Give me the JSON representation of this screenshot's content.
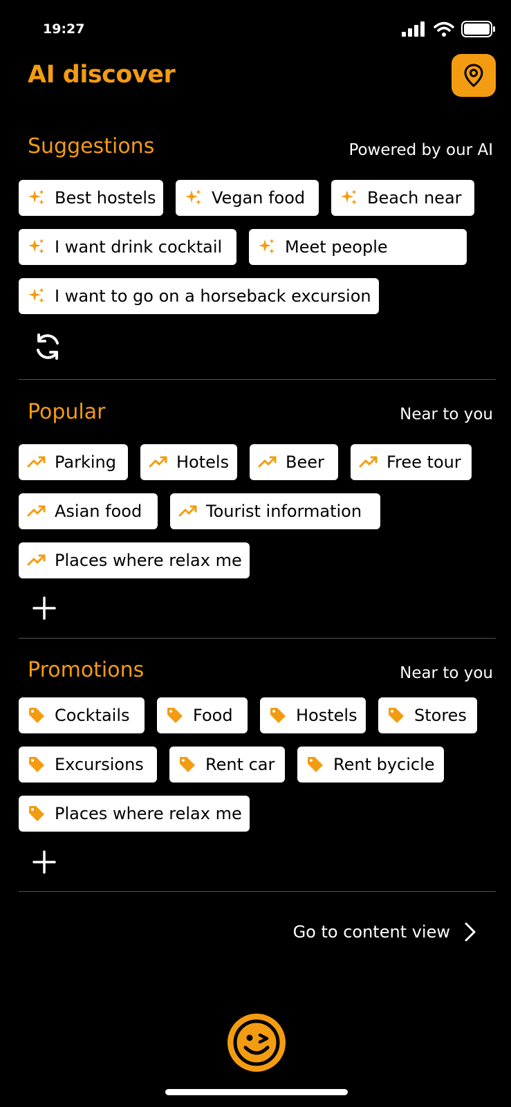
{
  "status": {
    "time": "19:27"
  },
  "header": {
    "title": "AI discover",
    "location_icon": "map-pin-icon"
  },
  "suggestions": {
    "title": "Suggestions",
    "subtitle": "Powered by our AI",
    "chip_icon": "sparkles-icon",
    "items": [
      "Best hostels",
      "Vegan food",
      "Beach near",
      "I want drink cocktail",
      "Meet people",
      "I want to go on a horseback excursion"
    ],
    "action_icon": "refresh-icon"
  },
  "popular": {
    "title": "Popular",
    "subtitle": "Near to you",
    "chip_icon": "trending-up-icon",
    "items": [
      "Parking",
      "Hotels",
      "Beer",
      "Free tour",
      "Asian food",
      "Tourist information",
      "Places where relax me"
    ],
    "action_icon": "plus-icon"
  },
  "promotions": {
    "title": "Promotions",
    "subtitle": "Near to you",
    "chip_icon": "tag-icon",
    "items": [
      "Cocktails",
      "Food",
      "Hostels",
      "Stores",
      "Excursions",
      "Rent car",
      "Rent bycicle",
      "Places where relax me"
    ],
    "action_icon": "plus-icon"
  },
  "footer": {
    "go_content_label": "Go to content view"
  },
  "colors": {
    "accent": "#f39c12",
    "background": "#000000",
    "chip": "#ffffff"
  }
}
